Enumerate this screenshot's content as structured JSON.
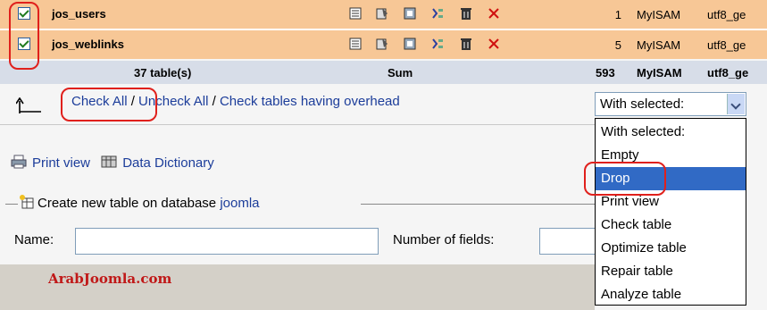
{
  "tables": [
    {
      "name": "jos_users",
      "rows": "1",
      "engine": "MyISAM",
      "collation": "utf8_ge",
      "checked": true
    },
    {
      "name": "jos_weblinks",
      "rows": "5",
      "engine": "MyISAM",
      "collation": "utf8_ge",
      "checked": true
    }
  ],
  "summary": {
    "tables": "37 table(s)",
    "sum_label": "Sum",
    "rows": "593",
    "engine": "MyISAM",
    "collation": "utf8_ge"
  },
  "check_links": {
    "check_all": "Check All",
    "sep1": " / ",
    "uncheck_all": "Uncheck All",
    "sep2": " / ",
    "check_overhead": "Check tables having overhead"
  },
  "with_selected": {
    "value": "With selected:",
    "options": [
      "With selected:",
      "Empty",
      "Drop",
      "Print view",
      "Check table",
      "Optimize table",
      "Repair table",
      "Analyze table"
    ],
    "highlighted": "Drop"
  },
  "links": {
    "print_view": "Print view",
    "data_dictionary": "Data Dictionary"
  },
  "create_table": {
    "prefix": "Create new table on database ",
    "database": "joomla"
  },
  "form": {
    "name_label": "Name:",
    "name_value": "",
    "fields_label": "Number of fields:",
    "fields_value": ""
  },
  "watermark": "ArabJoomla.com",
  "colors": {
    "row_bg": "#f7c796",
    "summary_bg": "#d7dde8",
    "link": "#1c3d9a",
    "highlight": "#316ac5",
    "annotation": "#e0201c"
  }
}
